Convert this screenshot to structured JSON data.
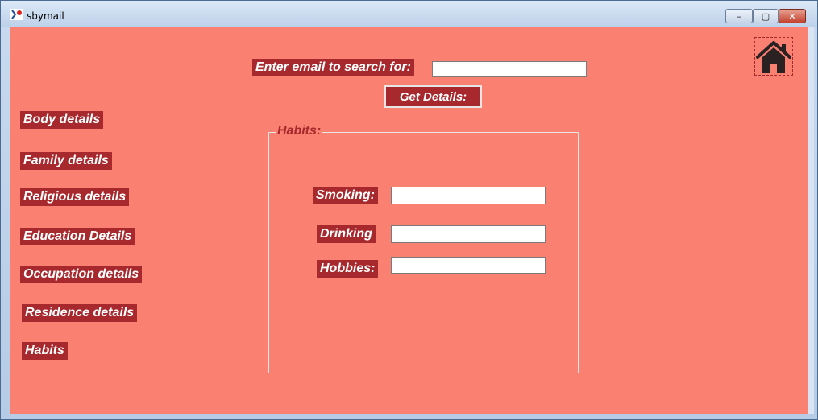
{
  "window": {
    "title": "sbymail",
    "min_label": "–",
    "max_label": "▢",
    "close_label": "✕"
  },
  "search": {
    "label": "Enter email to search for:",
    "value": "",
    "button": "Get Details:"
  },
  "sidebar": {
    "items": [
      {
        "label": "Body details"
      },
      {
        "label": "Family details"
      },
      {
        "label": "Religious details"
      },
      {
        "label": "Education Details"
      },
      {
        "label": "Occupation details"
      },
      {
        "label": "Residence details"
      },
      {
        "label": "Habits"
      }
    ]
  },
  "habits": {
    "title": "Habits:",
    "smoking": {
      "label": "Smoking:",
      "value": ""
    },
    "drinking": {
      "label": "Drinking",
      "value": ""
    },
    "hobbies": {
      "label": "Hobbies:",
      "value": ""
    }
  },
  "icons": {
    "home": "home-icon",
    "app": "app-icon"
  },
  "colors": {
    "background": "#fa8072",
    "label_bg": "#a8292d",
    "label_text": "#ffffff"
  }
}
